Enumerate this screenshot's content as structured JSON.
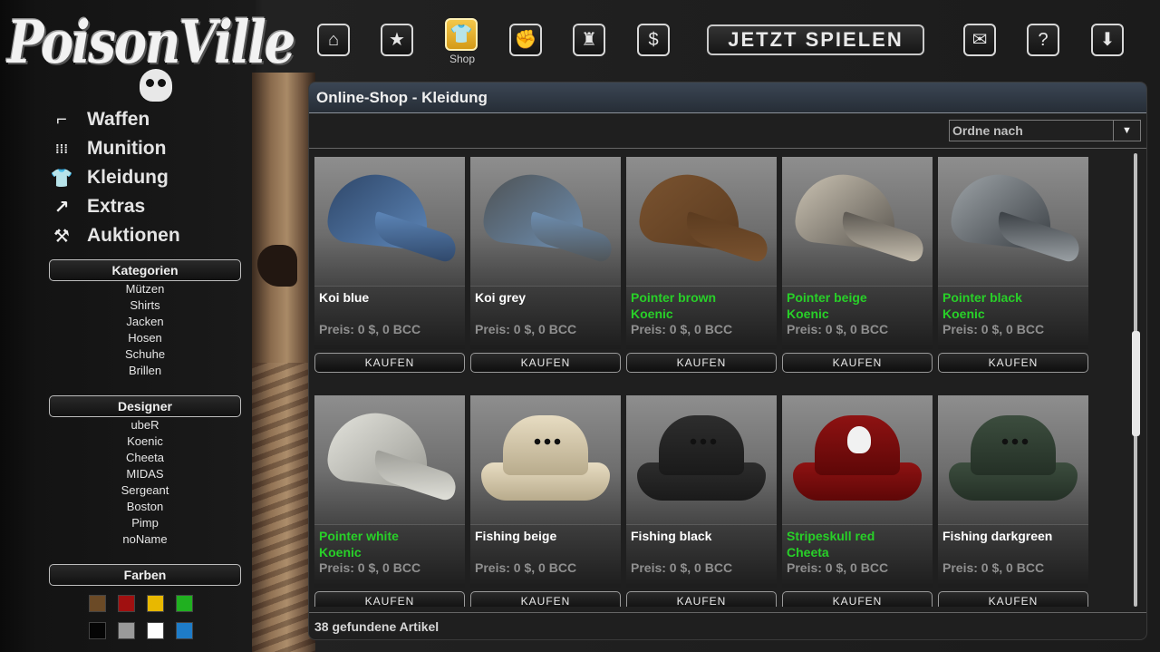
{
  "logo_text": "PoisonVille",
  "nav": {
    "items": [
      {
        "name": "home-icon",
        "glyph": "⌂"
      },
      {
        "name": "star-icon",
        "glyph": "★"
      },
      {
        "name": "shirt-icon",
        "glyph": "👕",
        "label": "Shop"
      },
      {
        "name": "fist-icon",
        "glyph": "✊"
      },
      {
        "name": "bottles-icon",
        "glyph": "♜"
      },
      {
        "name": "dollar-icon",
        "glyph": "$"
      },
      {
        "name": "chat-icon",
        "glyph": "✉"
      },
      {
        "name": "help-icon",
        "glyph": "?"
      },
      {
        "name": "download-icon",
        "glyph": "⬇"
      }
    ],
    "shop_label": "Shop",
    "play_label": "JETZT SPIELEN"
  },
  "sidebar": {
    "menu": [
      {
        "label": "Waffen",
        "icon": "pistol-icon",
        "glyph": "⌐"
      },
      {
        "label": "Munition",
        "icon": "ammo-icon",
        "glyph": "⁞⁞⁞"
      },
      {
        "label": "Kleidung",
        "icon": "shirt-icon",
        "glyph": "👕"
      },
      {
        "label": "Extras",
        "icon": "arrow-icon",
        "glyph": "↗"
      },
      {
        "label": "Auktionen",
        "icon": "gavel-icon",
        "glyph": "⚒"
      }
    ],
    "kategorien_title": "Kategorien",
    "kategorien": [
      "Mützen",
      "Shirts",
      "Jacken",
      "Hosen",
      "Schuhe",
      "Brillen"
    ],
    "designer_title": "Designer",
    "designer": [
      "ubeR",
      "Koenic",
      "Cheeta",
      "MIDAS",
      "Sergeant",
      "Boston",
      "Pimp",
      "noName"
    ],
    "farben_title": "Farben",
    "colors": [
      "#6b4a26",
      "#a01010",
      "#e8b800",
      "#20b020",
      "#050505",
      "#9a9a9a",
      "#ffffff",
      "#1e7cc8"
    ]
  },
  "panel": {
    "title": "Online-Shop - Kleidung",
    "sort_placeholder": "Ordne nach",
    "footer": "38 gefundene Artikel"
  },
  "products": [
    {
      "name": "Koi blue",
      "designer": "",
      "price": "Preis: 0 $, 0 BCC",
      "buy": "KAUFEN",
      "style": "cap",
      "color": "#2e4668",
      "accent": "#5d86b8"
    },
    {
      "name": "Koi grey",
      "designer": "",
      "price": "Preis: 0 $, 0 BCC",
      "buy": "KAUFEN",
      "style": "cap",
      "color": "#4e5254",
      "accent": "#6e8fb2"
    },
    {
      "name": "Pointer brown",
      "designer": "Koenic",
      "price": "Preis: 0 $, 0 BCC",
      "buy": "KAUFEN",
      "style": "cap",
      "color": "#7a5330",
      "accent": "#5b3b1f"
    },
    {
      "name": "Pointer beige",
      "designer": "Koenic",
      "price": "Preis: 0 $, 0 BCC",
      "buy": "KAUFEN",
      "style": "cap",
      "color": "#cbc3b3",
      "accent": "#5a5650"
    },
    {
      "name": "Pointer black",
      "designer": "Koenic",
      "price": "Preis: 0 $, 0 BCC",
      "buy": "KAUFEN",
      "style": "cap",
      "color": "#9ea4a8",
      "accent": "#3a3f44"
    },
    {
      "name": "Pointer white",
      "designer": "Koenic",
      "price": "Preis: 0 $, 0 BCC",
      "buy": "KAUFEN",
      "style": "cap",
      "color": "#e3e3dc",
      "accent": "#9c9c96"
    },
    {
      "name": "Fishing beige",
      "designer": "",
      "price": "Preis: 0 $, 0 BCC",
      "buy": "KAUFEN",
      "style": "hat",
      "color": "#e7dcc2",
      "accent": "#b8ab8c"
    },
    {
      "name": "Fishing black",
      "designer": "",
      "price": "Preis: 0 $, 0 BCC",
      "buy": "KAUFEN",
      "style": "hat",
      "color": "#2d2d2d",
      "accent": "#1a1a1a"
    },
    {
      "name": "Stripeskull red",
      "designer": "Cheeta",
      "price": "Preis: 0 $, 0 BCC",
      "buy": "KAUFEN",
      "style": "skullhat",
      "color": "#8e1212",
      "accent": "#5e0707"
    },
    {
      "name": "Fishing darkgreen",
      "designer": "",
      "price": "Preis: 0 $, 0 BCC",
      "buy": "KAUFEN",
      "style": "hat",
      "color": "#3c4d3e",
      "accent": "#243026"
    }
  ]
}
